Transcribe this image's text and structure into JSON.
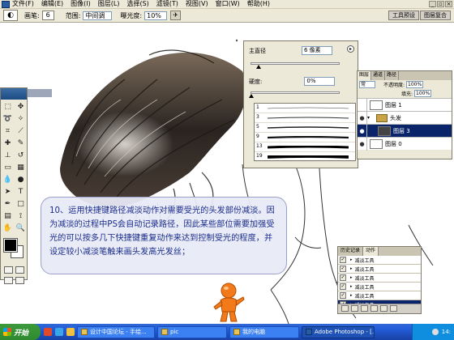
{
  "menubar": {
    "items": [
      "文件(F)",
      "编辑(E)",
      "图像(I)",
      "图层(L)",
      "选择(S)",
      "滤镜(T)",
      "视图(V)",
      "窗口(W)",
      "帮助(H)"
    ]
  },
  "options_bar": {
    "brush_label": "画笔:",
    "brush_size": "6",
    "range_label": "范围:",
    "range_value": "中间调",
    "exposure_label": "曝光度:",
    "exposure_value": "10%",
    "palette_tabs": [
      "工具预设",
      "图层复合"
    ]
  },
  "brush_panel": {
    "diameter_label": "主直径",
    "diameter_value": "6 像素",
    "hardness_label": "硬度:",
    "hardness_value": "0%",
    "brush_numbers": [
      "1",
      "3",
      "5",
      "9",
      "13",
      "19"
    ]
  },
  "layers_panel": {
    "tabs": [
      "图层",
      "通道",
      "路径"
    ],
    "mode_value": "常",
    "opacity_label": "不透明度:",
    "opacity_value": "100%",
    "fill_label": "填充:",
    "fill_value": "100%",
    "layers": [
      {
        "name": "图层 1",
        "type": "layer"
      },
      {
        "name": "头发",
        "type": "group"
      },
      {
        "name": "图层 3",
        "type": "layer",
        "selected": true
      },
      {
        "name": "图层 0",
        "type": "layer"
      }
    ]
  },
  "actions_panel": {
    "tabs": [
      "历史记录",
      "动作"
    ],
    "items": [
      "减淡工具",
      "减淡工具",
      "减淡工具",
      "减淡工具",
      "减淡工具",
      "减淡工具"
    ]
  },
  "caption": {
    "text": "10、运用快捷键路径减淡动作对需要受光的头发部份减淡。因为减淡的过程中PS会自动记录路径，因此某些部位需要加强受光的可以按多几下快捷键重复动作来达到控制受光的程度，并设定较小减淡笔触来画头发高光发丝；"
  },
  "taskbar": {
    "start_label": "开始",
    "buttons": [
      "设计中国论坛 - 手绘...",
      "pic",
      "我的电脑",
      "Adobe Photoshop - [..."
    ],
    "clock": "14:"
  },
  "colors": {
    "caption_text": "#1b2d8a",
    "selection": "#0a246a",
    "taskbar": "#245edb"
  }
}
